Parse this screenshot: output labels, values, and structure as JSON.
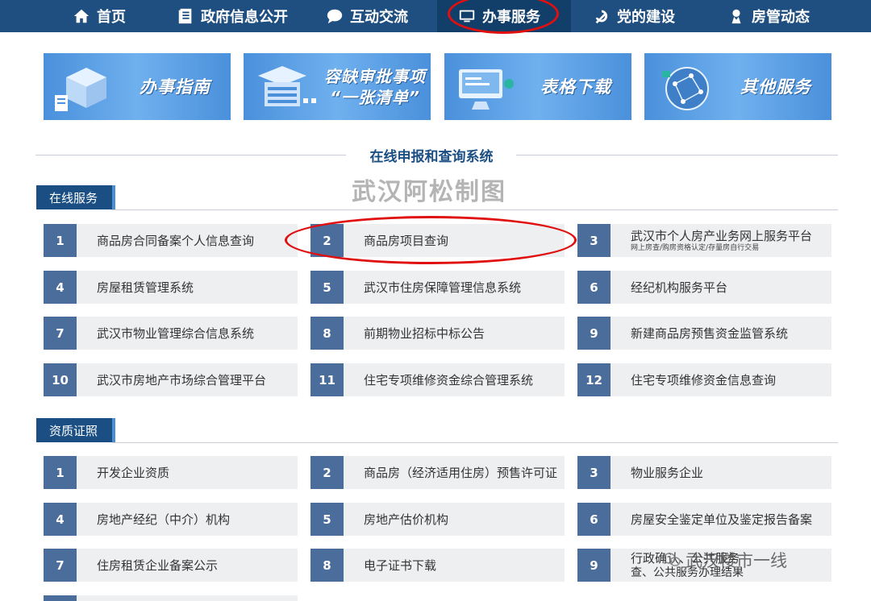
{
  "nav": {
    "items": [
      {
        "label": "首页",
        "icon": "home-icon"
      },
      {
        "label": "政府信息公开",
        "icon": "document-icon"
      },
      {
        "label": "互动交流",
        "icon": "chat-bubble-icon"
      },
      {
        "label": "办事服务",
        "icon": "monitor-icon"
      },
      {
        "label": "党的建设",
        "icon": "hammer-sickle-icon"
      },
      {
        "label": "房管动态",
        "icon": "person-badge-icon"
      }
    ],
    "active_index": 3
  },
  "banners": [
    {
      "title": "办事指南",
      "subtitle": ""
    },
    {
      "title": "容缺审批事项",
      "subtitle": "“一张清单”"
    },
    {
      "title": "表格下载",
      "subtitle": ""
    },
    {
      "title": "其他服务",
      "subtitle": ""
    }
  ],
  "system_title": "在线申报和查询系统",
  "watermark": "武汉阿松制图",
  "online_section": {
    "title": "在线服务",
    "items": [
      {
        "num": "1",
        "label": "商品房合同备案个人信息查询",
        "sub": ""
      },
      {
        "num": "2",
        "label": "商品房项目查询",
        "sub": ""
      },
      {
        "num": "3",
        "label": "武汉市个人房产业务网上服务平台",
        "sub": "网上房查/购房资格认定/存量房自行交易"
      },
      {
        "num": "4",
        "label": "房屋租赁管理系统",
        "sub": ""
      },
      {
        "num": "5",
        "label": "武汉市住房保障管理信息系统",
        "sub": ""
      },
      {
        "num": "6",
        "label": "经纪机构服务平台",
        "sub": ""
      },
      {
        "num": "7",
        "label": "武汉市物业管理综合信息系统",
        "sub": ""
      },
      {
        "num": "8",
        "label": "前期物业招标中标公告",
        "sub": ""
      },
      {
        "num": "9",
        "label": "新建商品房预售资金监管系统",
        "sub": ""
      },
      {
        "num": "10",
        "label": "武汉市房地产市场综合管理平台",
        "sub": ""
      },
      {
        "num": "11",
        "label": "住宅专项维修资金综合管理系统",
        "sub": ""
      },
      {
        "num": "12",
        "label": "住宅专项维修资金信息查询",
        "sub": ""
      }
    ]
  },
  "qualification_section": {
    "title": "资质证照",
    "items": [
      {
        "num": "1",
        "label": "开发企业资质",
        "sub": ""
      },
      {
        "num": "2",
        "label": "商品房（经济适用住房）预售许可证",
        "sub": ""
      },
      {
        "num": "3",
        "label": "物业服务企业",
        "sub": ""
      },
      {
        "num": "4",
        "label": "房地产经纪（中介）机构",
        "sub": ""
      },
      {
        "num": "5",
        "label": "房地产估价机构",
        "sub": ""
      },
      {
        "num": "6",
        "label": "房屋安全鉴定单位及鉴定报告备案",
        "sub": ""
      },
      {
        "num": "7",
        "label": "住房租赁企业备案公示",
        "sub": ""
      },
      {
        "num": "8",
        "label": "电子证书下载",
        "sub": ""
      },
      {
        "num": "9",
        "label": "行政确认、公共服务",
        "sub": "查、公共服务办理结果"
      }
    ]
  },
  "wechat_watermark": "武汉楼市一线",
  "colors": {
    "nav": "#1f4f80",
    "nav_active": "#123e6a",
    "accent": "#1b4f84",
    "num_box": "#4b6d9c",
    "highlight": "#e01010"
  }
}
